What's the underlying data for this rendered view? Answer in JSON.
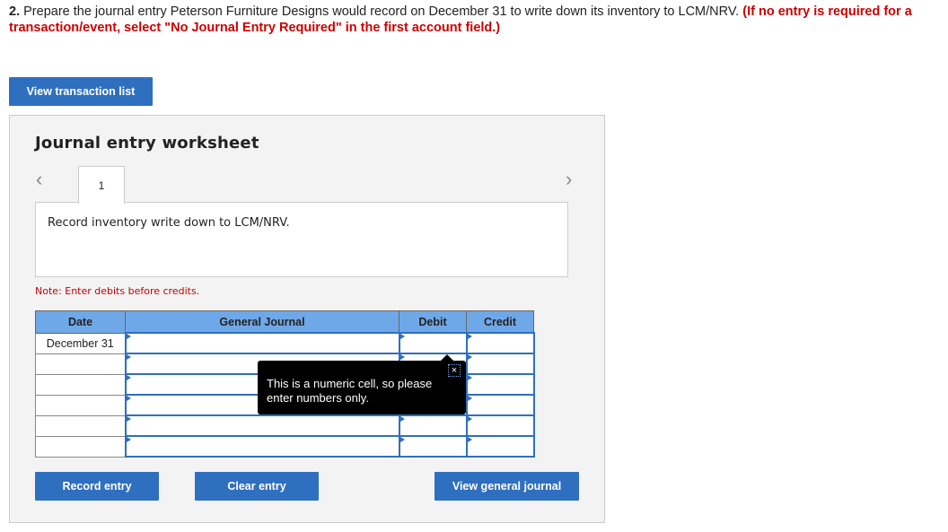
{
  "question": {
    "number": "2.",
    "text": "Prepare the journal entry Peterson Furniture Designs would record on December 31 to write down its inventory to LCM/NRV.",
    "instruction": "(If no entry is required for a transaction/event, select \"No Journal Entry Required\" in the first account field.)"
  },
  "view_transaction_list": "View transaction list",
  "worksheet": {
    "title": "Journal entry worksheet",
    "tab": "1",
    "description": "Record inventory write down to LCM/NRV.",
    "note": "Note: Enter debits before credits."
  },
  "table": {
    "headers": [
      "Date",
      "General Journal",
      "Debit",
      "Credit"
    ],
    "rows": [
      {
        "date": "December 31"
      },
      {
        "date": ""
      },
      {
        "date": ""
      },
      {
        "date": ""
      },
      {
        "date": ""
      },
      {
        "date": ""
      }
    ]
  },
  "tooltip": {
    "text": "This is a numeric cell, so please enter numbers only.",
    "close": "×"
  },
  "buttons": {
    "record": "Record entry",
    "clear": "Clear entry",
    "view_journal": "View general journal"
  },
  "colors": {
    "accent": "#2f6fbf",
    "header": "#6fa8e8",
    "warning": "#cc0000"
  }
}
